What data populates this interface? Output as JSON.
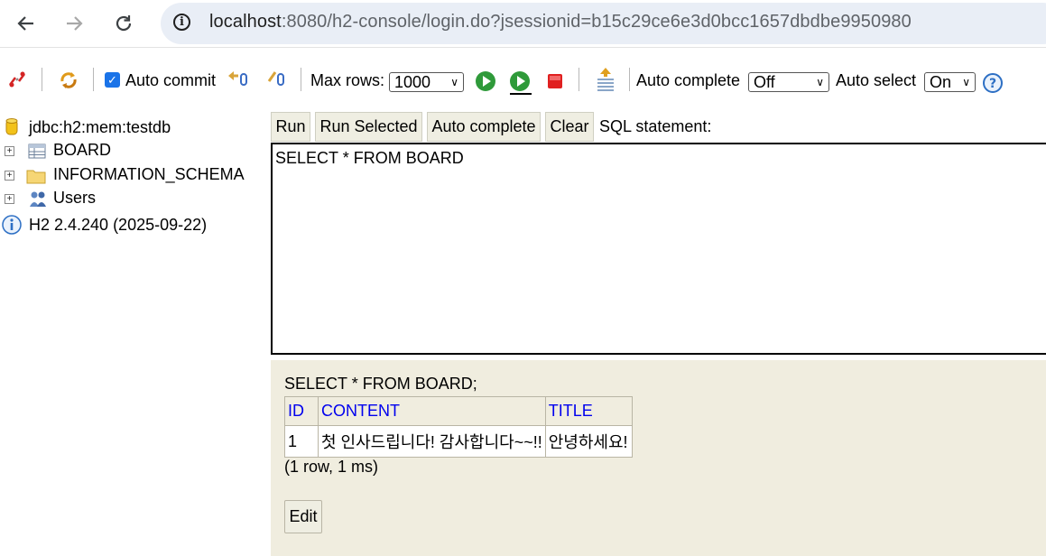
{
  "browser": {
    "url_host": "localhost",
    "url_rest": ":8080/h2-console/login.do?jsessionid=b15c29ce6e3d0bcc1657dbdbe9950980"
  },
  "toolbar": {
    "auto_commit_label": "Auto commit",
    "auto_commit_checked": true,
    "max_rows_label": "Max rows:",
    "max_rows_value": "1000",
    "auto_complete_label": "Auto complete",
    "auto_complete_value": "Off",
    "auto_select_label": "Auto select",
    "auto_select_value": "On"
  },
  "tree": {
    "connection": "jdbc:h2:mem:testdb",
    "items": [
      {
        "label": "BOARD",
        "icon": "table-icon"
      },
      {
        "label": "INFORMATION_SCHEMA",
        "icon": "folder-icon"
      },
      {
        "label": "Users",
        "icon": "users-icon"
      }
    ],
    "version": "H2 2.4.240 (2025-09-22)"
  },
  "query": {
    "buttons": [
      "Run",
      "Run Selected",
      "Auto complete",
      "Clear"
    ],
    "sql_label": "SQL statement:",
    "sql_text": "SELECT * FROM BOARD"
  },
  "result": {
    "statement": "SELECT * FROM BOARD;",
    "columns": [
      "ID",
      "CONTENT",
      "TITLE"
    ],
    "rows": [
      [
        "1",
        "첫 인사드립니다! 감사합니다~~!!",
        "안녕하세요!"
      ]
    ],
    "summary": "(1 row, 1 ms)",
    "edit_label": "Edit"
  },
  "colors": {
    "result_bg": "#f0eddf",
    "header_link": "#0000ee",
    "button_bg": "#efeee2",
    "checkbox": "#1a73e8"
  }
}
